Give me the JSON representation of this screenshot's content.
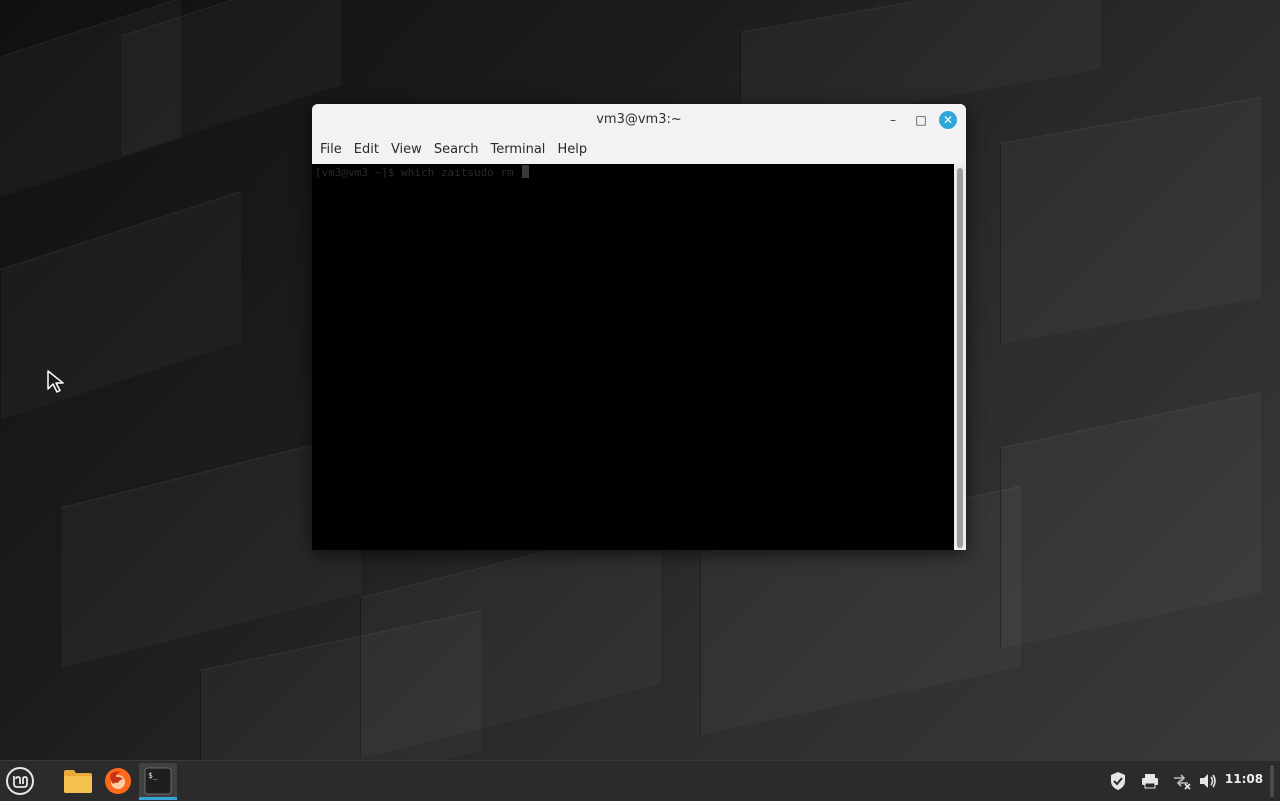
{
  "window": {
    "title": "vm3@vm3:~",
    "controls": {
      "minimize": "–",
      "maximize": "□",
      "close": "✕"
    }
  },
  "menubar": {
    "items": [
      "File",
      "Edit",
      "View",
      "Search",
      "Terminal",
      "Help"
    ]
  },
  "terminal": {
    "prompt_text": "[vm3@vm3 ~]$ which zaitsudo rm "
  },
  "taskbar": {
    "clock": "11:08",
    "launchers": [
      "menu-icon",
      "files-folder-icon",
      "firefox-icon",
      "terminal-icon"
    ],
    "tray": [
      "shield-icon",
      "printer-icon",
      "network-disconnected-icon",
      "volume-icon"
    ],
    "accent_color": "#35a4d4"
  },
  "colors": {
    "close_button": "#2ea6d8",
    "terminal_background": "#000000",
    "titlebar": "#f2f2f2"
  }
}
